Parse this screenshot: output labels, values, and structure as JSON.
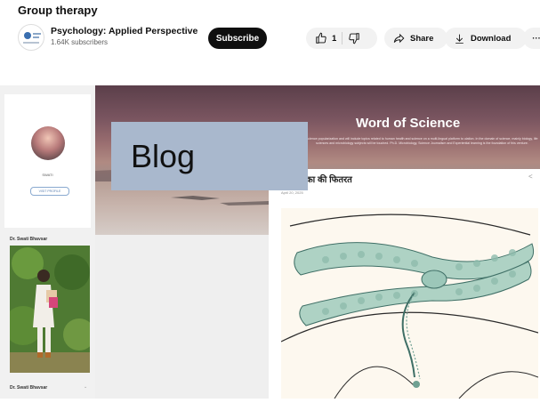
{
  "video": {
    "title": "Group therapy"
  },
  "channel": {
    "name": "Psychology: Applied Perspective",
    "subscribers": "1.64K subscribers",
    "subscribe_label": "Subscribe",
    "logo_icon": "channel-logo-icon"
  },
  "actions": {
    "like_count": "1",
    "share_label": "Share",
    "download_label": "Download",
    "more_label": "···"
  },
  "embedded_blog": {
    "site_title": "Word of Science",
    "site_description": "science popularization and will include topics related to human health and science on a multi-lingual platform to ulation. In the domain of science, mainly biology, life sciences and microbiology subjects will be touched. Ph.D. Microbiology, Science Journalism and Experiential learning is the foundation of this venture.",
    "post_title": "का की फितरत",
    "post_date": "April 20, 2025",
    "profile_name": "SWATI",
    "visit_profile_label": "VISIT PROFILE",
    "author_label": "Dr. Swati Bhavsar",
    "author_label_bottom": "Dr. Swati Bhavsar"
  },
  "overlay": {
    "label": "Blog"
  },
  "colors": {
    "subscribe_bg": "#0f0f0f",
    "pill_bg": "#f2f2f2",
    "overlay_box": "#a9b8cd",
    "header_band": "#7a5560"
  }
}
